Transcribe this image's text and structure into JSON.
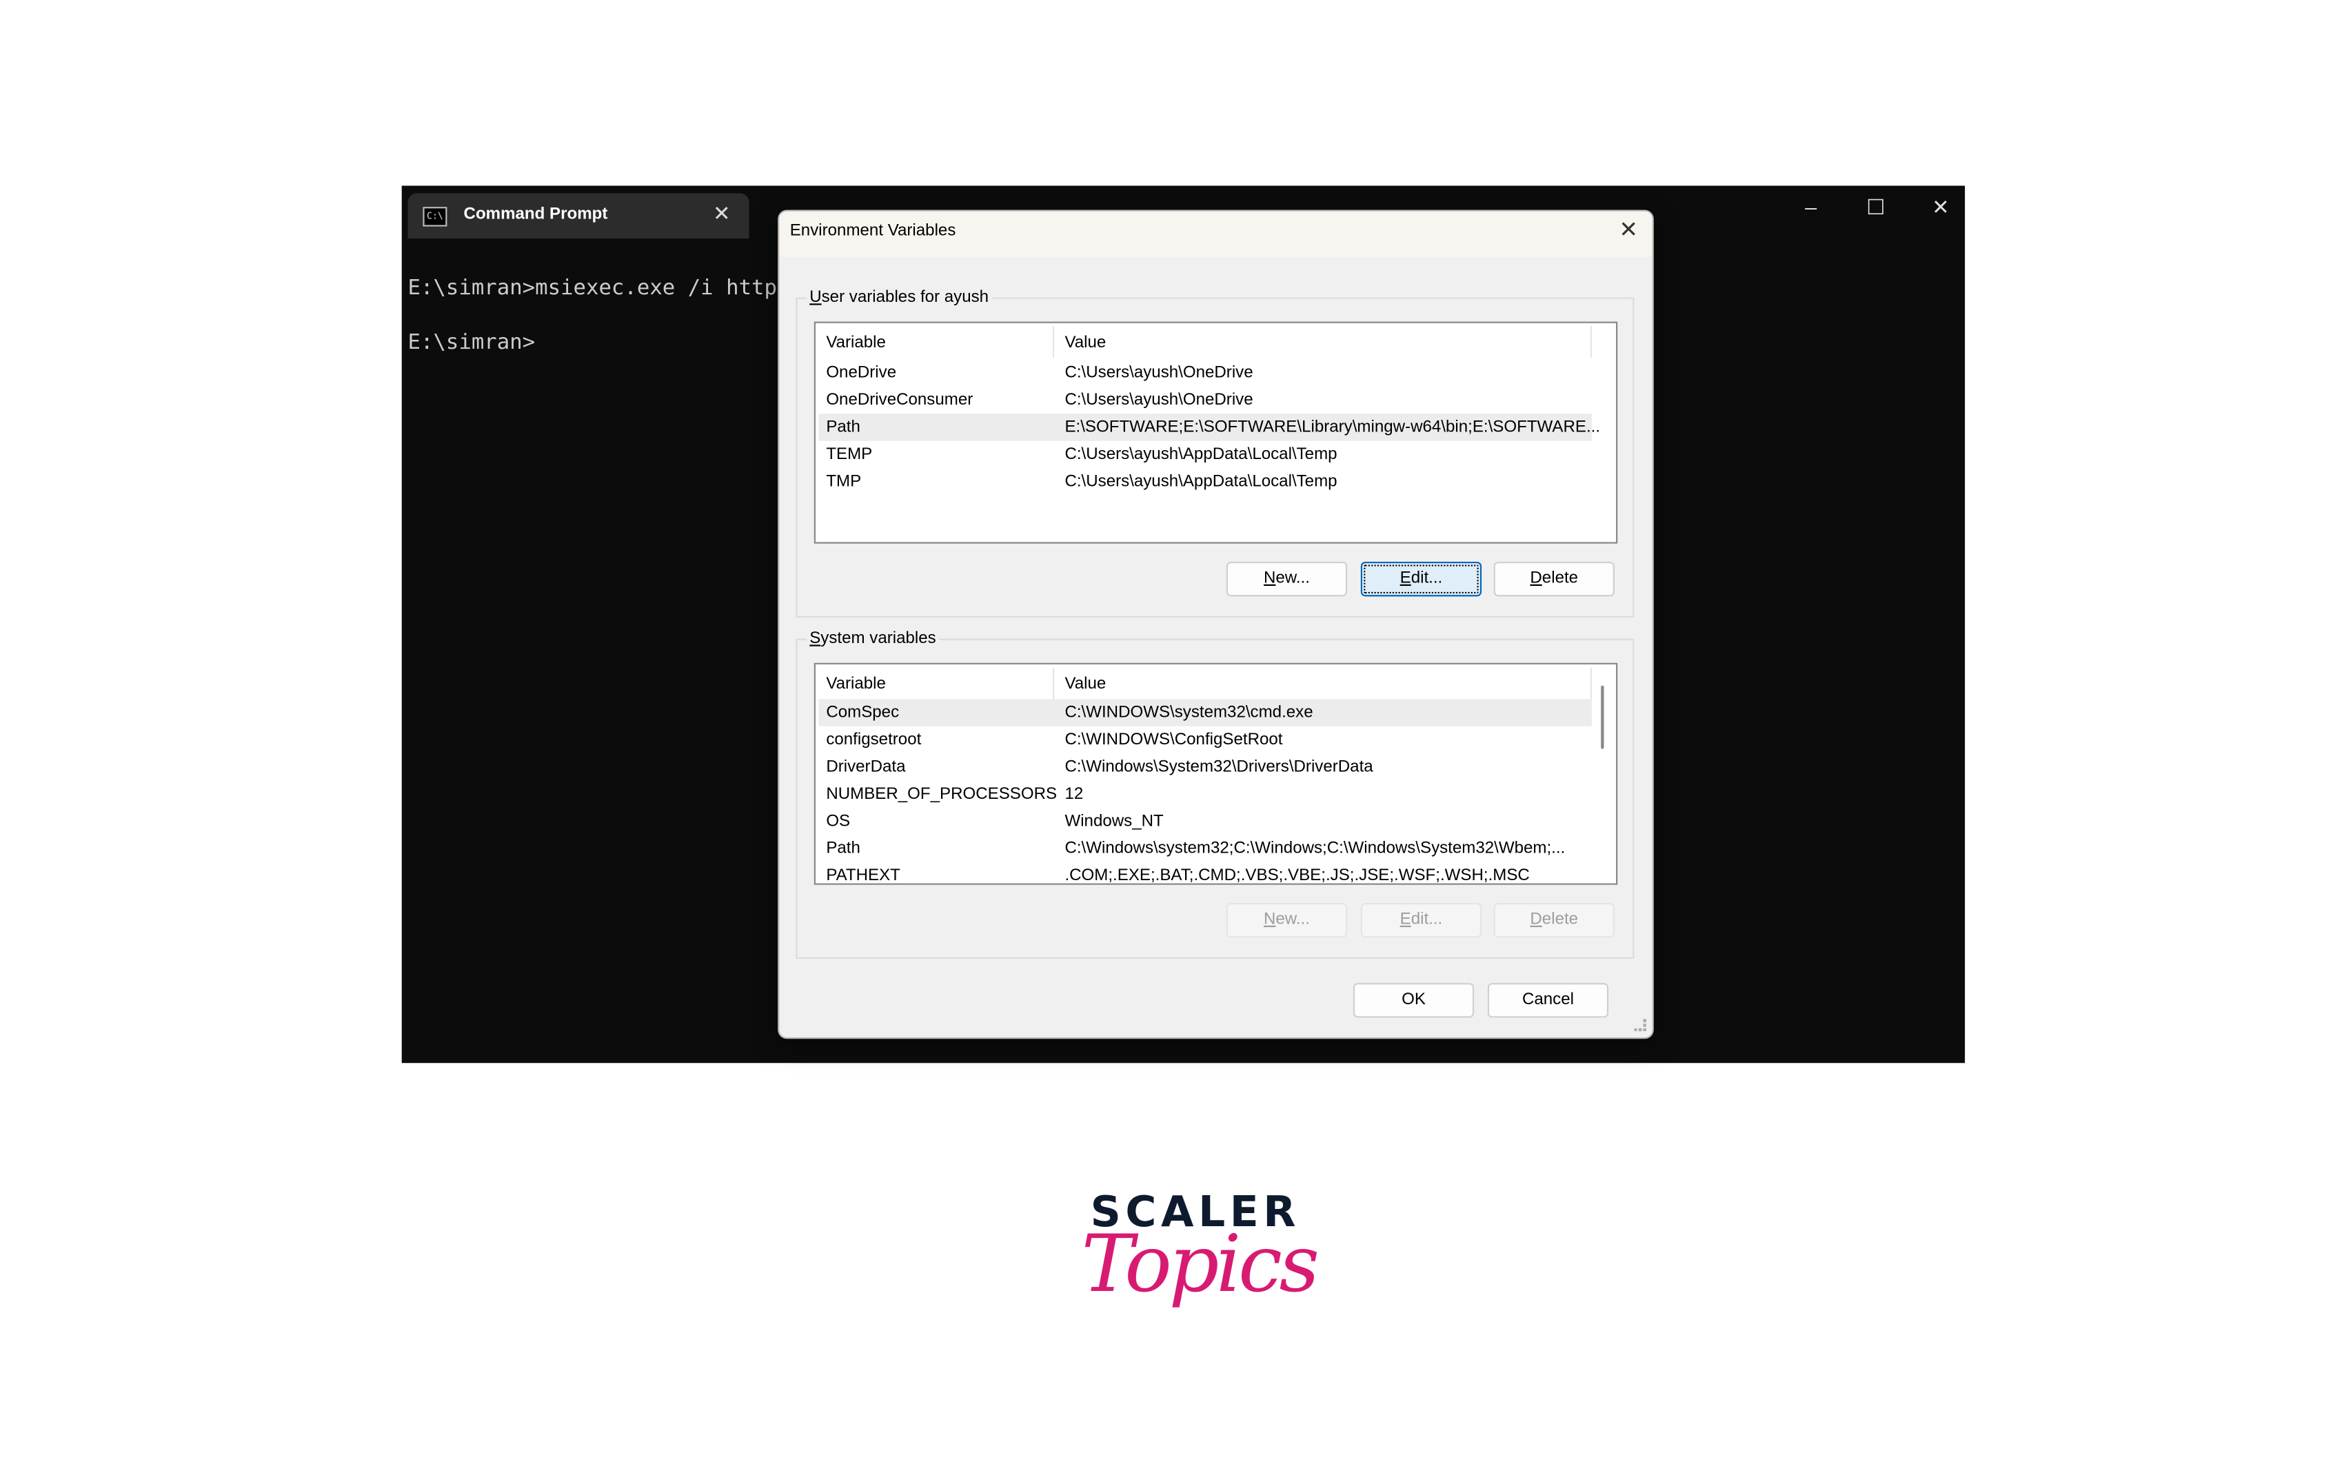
{
  "terminal": {
    "tab_title": "Command Prompt",
    "tab_icon": "cmd-icon",
    "lines": [
      "E:\\simran>msiexec.exe /i http",
      "E:\\simran>"
    ],
    "controls": {
      "minimize": "–",
      "maximize": "☐",
      "close": "✕"
    },
    "tab_close": "✕"
  },
  "dialog": {
    "title": "Environment Variables",
    "close": "✕",
    "user_group": {
      "label": "User variables for ayush",
      "headers": {
        "variable": "Variable",
        "value": "Value"
      },
      "rows": [
        {
          "variable": "OneDrive",
          "value": "C:\\Users\\ayush\\OneDrive"
        },
        {
          "variable": "OneDriveConsumer",
          "value": "C:\\Users\\ayush\\OneDrive"
        },
        {
          "variable": "Path",
          "value": "E:\\SOFTWARE;E:\\SOFTWARE\\Library\\mingw-w64\\bin;E:\\SOFTWARE...",
          "selected": true
        },
        {
          "variable": "TEMP",
          "value": "C:\\Users\\ayush\\AppData\\Local\\Temp"
        },
        {
          "variable": "TMP",
          "value": "C:\\Users\\ayush\\AppData\\Local\\Temp"
        }
      ],
      "buttons": {
        "new": "New...",
        "edit": "Edit...",
        "delete": "Delete"
      }
    },
    "system_group": {
      "label": "System variables",
      "headers": {
        "variable": "Variable",
        "value": "Value"
      },
      "rows": [
        {
          "variable": "ComSpec",
          "value": "C:\\WINDOWS\\system32\\cmd.exe",
          "selected": true
        },
        {
          "variable": "configsetroot",
          "value": "C:\\WINDOWS\\ConfigSetRoot"
        },
        {
          "variable": "DriverData",
          "value": "C:\\Windows\\System32\\Drivers\\DriverData"
        },
        {
          "variable": "NUMBER_OF_PROCESSORS",
          "value": "12"
        },
        {
          "variable": "OS",
          "value": "Windows_NT"
        },
        {
          "variable": "Path",
          "value": "C:\\Windows\\system32;C:\\Windows;C:\\Windows\\System32\\Wbem;..."
        },
        {
          "variable": "PATHEXT",
          "value": ".COM;.EXE;.BAT;.CMD;.VBS;.VBE;.JS;.JSE;.WSF;.WSH;.MSC"
        }
      ],
      "buttons": {
        "new": "New...",
        "edit": "Edit...",
        "delete": "Delete"
      }
    },
    "ok": "OK",
    "cancel": "Cancel"
  },
  "logo": {
    "line1": "SCALER",
    "line2": "Topics",
    "colors": {
      "scaler": "#0e1a2e",
      "topics": "#d81b72"
    }
  }
}
